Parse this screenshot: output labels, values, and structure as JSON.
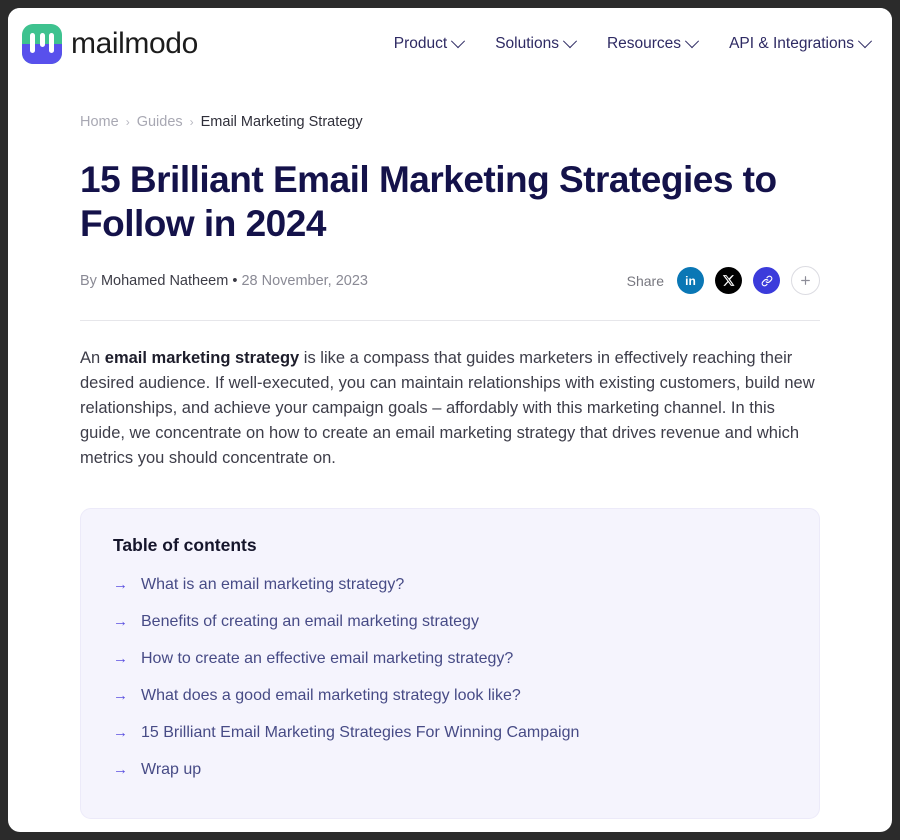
{
  "header": {
    "brand_name": "mailmodo",
    "nav": [
      {
        "label": "Product"
      },
      {
        "label": "Solutions"
      },
      {
        "label": "Resources"
      },
      {
        "label": "API & Integrations"
      }
    ]
  },
  "breadcrumb": {
    "separator": "›",
    "items": [
      {
        "label": "Home"
      },
      {
        "label": "Guides"
      },
      {
        "label": "Email Marketing Strategy"
      }
    ]
  },
  "article": {
    "title": "15 Brilliant Email Marketing Strategies to Follow in 2024",
    "byline": {
      "prefix": "By",
      "author": "Mohamed Natheem",
      "separator": "•",
      "date": "28 November, 2023"
    },
    "share": {
      "label": "Share",
      "buttons": [
        {
          "name": "linkedin",
          "glyph": "in"
        },
        {
          "name": "x-twitter",
          "glyph": "✕"
        },
        {
          "name": "copy-link",
          "glyph": "🔗"
        },
        {
          "name": "more",
          "glyph": "+"
        }
      ]
    },
    "intro": {
      "lead": "An ",
      "bold": "email marketing strategy",
      "rest": " is like a compass that guides marketers in effectively reaching their desired audience. If well-executed, you can maintain relationships with existing customers, build new relationships, and achieve your campaign goals – affordably with this marketing channel. In this guide, we concentrate on how to create an email marketing strategy that drives revenue and which metrics you should concentrate on."
    }
  },
  "toc": {
    "title": "Table of contents",
    "arrow": "→",
    "items": [
      {
        "label": "What is an email marketing strategy?"
      },
      {
        "label": "Benefits of creating an email marketing strategy"
      },
      {
        "label": "How to create an effective email marketing strategy?"
      },
      {
        "label": "What does a good email marketing strategy look like?"
      },
      {
        "label": "15 Brilliant Email Marketing Strategies For Winning Campaign"
      },
      {
        "label": "Wrap up"
      }
    ]
  },
  "colors": {
    "brand_green": "#3ec28f",
    "brand_blue": "#5850ec",
    "title_navy": "#14124a",
    "toc_bg": "#f5f4fd",
    "toc_link": "#474b86",
    "accent_purple": "#5a4fe0"
  }
}
